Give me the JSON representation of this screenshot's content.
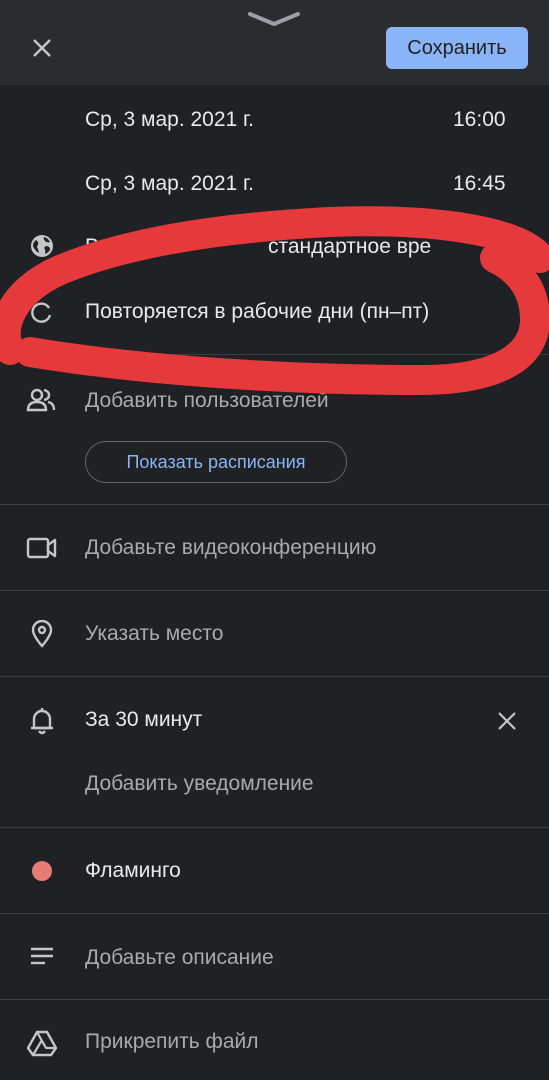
{
  "header": {
    "save_label": "Сохранить"
  },
  "event": {
    "start_date": "Ср, 3 мар. 2021 г.",
    "start_time": "16:00",
    "end_date": "Ср, 3 мар. 2021 г.",
    "end_time": "16:45",
    "timezone_visible": "Вл",
    "timezone_tail": "стандартное вре",
    "recurrence": "Повторяется в рабочие дни (пн–пт)"
  },
  "guests": {
    "add_label": "Добавить пользователей",
    "schedule_button": "Показать расписания"
  },
  "video": {
    "label": "Добавьте видеоконференцию"
  },
  "location": {
    "label": "Указать место"
  },
  "notifications": {
    "current": "За 30 минут",
    "add_label": "Добавить уведомление"
  },
  "color": {
    "label": "Фламинго",
    "hex": "#e67c73"
  },
  "description": {
    "label": "Добавьте описание"
  },
  "attachment": {
    "label": "Прикрепить файл"
  },
  "theme": {
    "background": "#202124",
    "accent": "#8ab4f8",
    "annotation": "#e5393b"
  }
}
